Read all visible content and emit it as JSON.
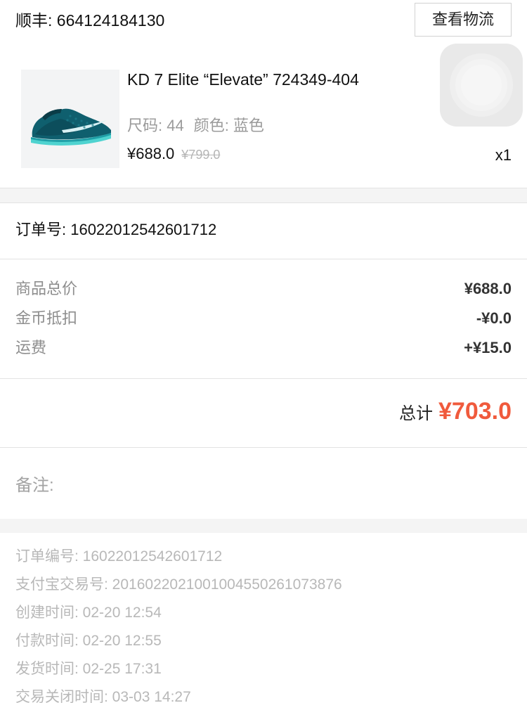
{
  "shipping": {
    "carrier_label": "顺丰: 664124184130",
    "logistics_button": "查看物流"
  },
  "product": {
    "title": "KD 7 Elite “Elevate” 724349-404",
    "size_label": "尺码: 44",
    "color_label": "颜色: 蓝色",
    "price": "¥688.0",
    "original_price": "¥799.0",
    "quantity": "x1",
    "image_icon": "sneaker-image"
  },
  "order": {
    "order_number_label": "订单号: 16022012542601712"
  },
  "fees": [
    {
      "label": "商品总价",
      "value": "¥688.0"
    },
    {
      "label": "金币抵扣",
      "value": "-¥0.0"
    },
    {
      "label": "运费",
      "value": "+¥15.0"
    }
  ],
  "total": {
    "label": "总计",
    "value": "¥703.0"
  },
  "remark": {
    "label": "备注:"
  },
  "details": [
    "订单编号: 16022012542601712",
    "支付宝交易号: 2016022021001004550261073876",
    "创建时间: 02-20 12:54",
    "付款时间: 02-20 12:55",
    "发货时间: 02-25 17:31",
    "交易关闭时间: 03-03 14:27"
  ],
  "colors": {
    "total_accent": "#f05a3c",
    "muted_text": "#9b9b9b",
    "divider": "#e3e3e3"
  }
}
